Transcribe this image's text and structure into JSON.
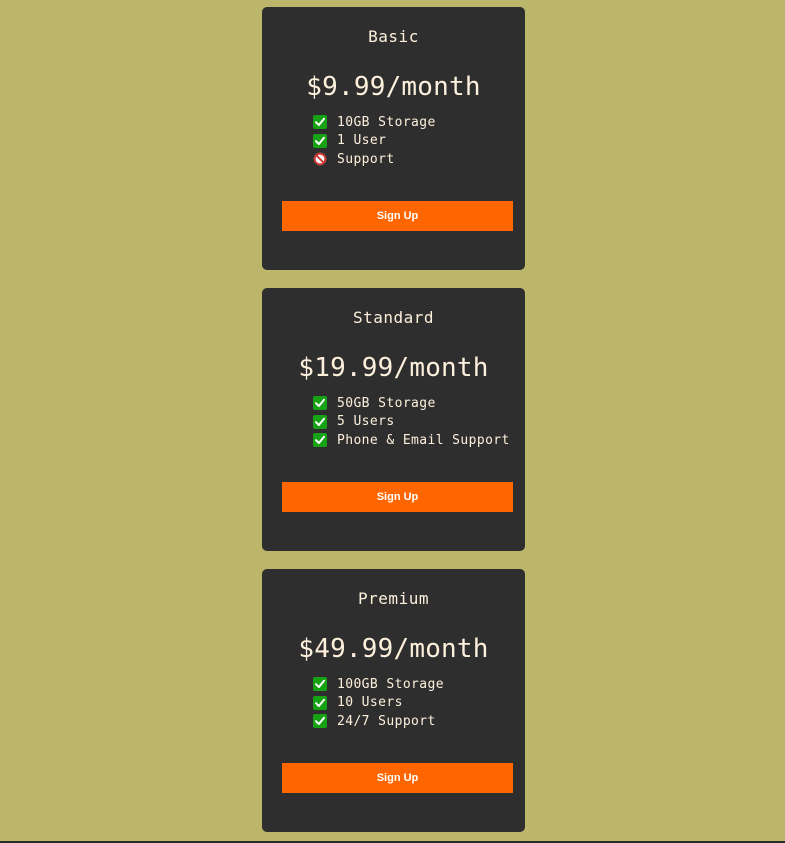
{
  "plans": [
    {
      "title": "Basic",
      "price": "$9.99/month",
      "features": [
        {
          "text": "10GB Storage",
          "included": true
        },
        {
          "text": "1 User",
          "included": true
        },
        {
          "text": "Support",
          "included": false
        }
      ],
      "button_label": "Sign Up"
    },
    {
      "title": "Standard",
      "price": "$19.99/month",
      "features": [
        {
          "text": "50GB Storage",
          "included": true
        },
        {
          "text": "5 Users",
          "included": true
        },
        {
          "text": "Phone & Email Support",
          "included": true
        }
      ],
      "button_label": "Sign Up"
    },
    {
      "title": "Premium",
      "price": "$49.99/month",
      "features": [
        {
          "text": "100GB Storage",
          "included": true
        },
        {
          "text": "10 Users",
          "included": true
        },
        {
          "text": "24/7 Support",
          "included": true
        }
      ],
      "button_label": "Sign Up"
    }
  ],
  "icons": {
    "included": "check-mark-icon",
    "excluded": "prohibited-icon"
  },
  "colors": {
    "page_background": "#bbb66a",
    "card_background": "#2e2e2e",
    "text": "#fdf0dc",
    "button": "#ff6600",
    "button_text": "#ffffff",
    "check_green": "#16a214",
    "prohibited_red": "#d0302a"
  }
}
